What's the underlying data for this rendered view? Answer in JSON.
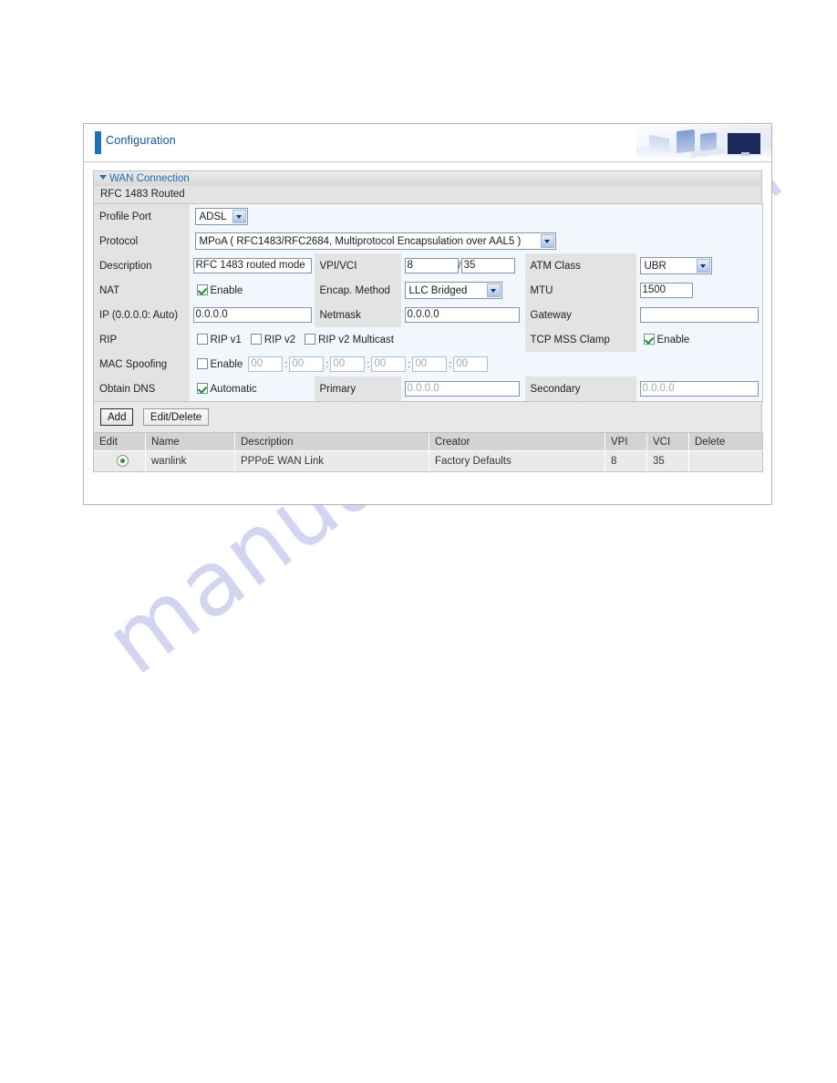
{
  "header": {
    "title": "Configuration",
    "art_name": "office-workstations-illustration"
  },
  "section": {
    "title": "WAN Connection",
    "subsection": "RFC 1483 Routed"
  },
  "form": {
    "profile_port": {
      "label": "Profile Port",
      "value": "ADSL"
    },
    "protocol": {
      "label": "Protocol",
      "value": "MPoA ( RFC1483/RFC2684, Multiprotocol Encapsulation over AAL5 )"
    },
    "description": {
      "label": "Description",
      "value": "RFC 1483 routed mode"
    },
    "vpivci": {
      "label": "VPI/VCI",
      "vpi": "8",
      "separator": "/",
      "vci": "35"
    },
    "atm_class": {
      "label": "ATM Class",
      "value": "UBR"
    },
    "nat": {
      "label": "NAT",
      "checkbox_label": "Enable",
      "checked": true
    },
    "encap_method": {
      "label": "Encap. Method",
      "value": "LLC Bridged"
    },
    "mtu": {
      "label": "MTU",
      "value": "1500"
    },
    "ip": {
      "label": "IP (0.0.0.0: Auto)",
      "value": "0.0.0.0"
    },
    "netmask": {
      "label": "Netmask",
      "value": "0.0.0.0"
    },
    "gateway": {
      "label": "Gateway",
      "value": ""
    },
    "rip": {
      "label": "RIP",
      "options": [
        {
          "label": "RIP v1",
          "checked": false
        },
        {
          "label": "RIP v2",
          "checked": false
        },
        {
          "label": "RIP v2 Multicast",
          "checked": false
        }
      ]
    },
    "tcp_mss_clamp": {
      "label": "TCP MSS Clamp",
      "checkbox_label": "Enable",
      "checked": true
    },
    "mac_spoofing": {
      "label": "MAC Spoofing",
      "checkbox_label": "Enable",
      "checked": false,
      "octet_placeholder": "00",
      "octets": [
        "00",
        "00",
        "00",
        "00",
        "00",
        "00"
      ],
      "separator": ":"
    },
    "obtain_dns": {
      "label": "Obtain DNS",
      "checkbox_label": "Automatic",
      "checked": true
    },
    "dns_primary": {
      "label": "Primary",
      "placeholder": "0.0.0.0",
      "value": "0.0.0.0"
    },
    "dns_secondary": {
      "label": "Secondary",
      "placeholder": "0.0.0.0",
      "value": "0.0.0.0"
    }
  },
  "buttons": {
    "add": "Add",
    "edit_delete": "Edit/Delete"
  },
  "table": {
    "columns": [
      "Edit",
      "Name",
      "Description",
      "Creator",
      "VPI",
      "VCI",
      "Delete"
    ],
    "rows": [
      {
        "edit_selected": true,
        "name": "wanlink",
        "description": "PPPoE WAN Link",
        "creator": "Factory Defaults",
        "vpi": "8",
        "vci": "35",
        "delete": ""
      }
    ]
  },
  "watermark": {
    "text": "manualshive.com"
  },
  "colors": {
    "accent_blue": "#1f6fb5",
    "title_blue": "#15508f",
    "section_blue": "#2b6aab",
    "field_bg": "#f2f7fd",
    "label_bg": "#e3e3e3",
    "header_grey": "#d3d3d3",
    "check_green": "#1a8a2e",
    "radio_green": "#2f8f3a",
    "watermark": "#b9bbe6"
  }
}
